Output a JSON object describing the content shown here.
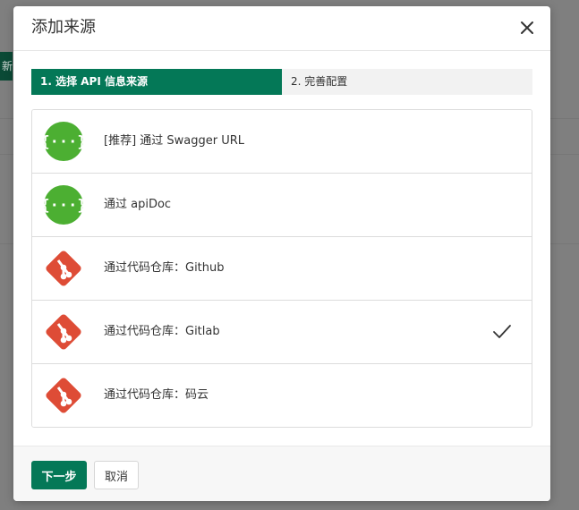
{
  "background": {
    "chip_text": "新"
  },
  "modal": {
    "title": "添加来源"
  },
  "steps": [
    {
      "label": "1. 选择 API 信息来源",
      "active": true
    },
    {
      "label": "2. 完善配置",
      "active": false
    }
  ],
  "sources": [
    {
      "label": "[推荐] 通过 Swagger URL",
      "icon": "swagger-icon",
      "selected": false
    },
    {
      "label": "通过 apiDoc",
      "icon": "swagger-icon",
      "selected": false
    },
    {
      "label": "通过代码仓库：Github",
      "icon": "git-icon",
      "selected": false
    },
    {
      "label": "通过代码仓库：Gitlab",
      "icon": "git-icon",
      "selected": true
    },
    {
      "label": "通过代码仓库：码云",
      "icon": "git-icon",
      "selected": false
    }
  ],
  "footer": {
    "next_label": "下一步",
    "cancel_label": "取消"
  },
  "colors": {
    "primary": "#047857",
    "swagger_green": "#4caf32",
    "git_red": "#de4c36"
  }
}
